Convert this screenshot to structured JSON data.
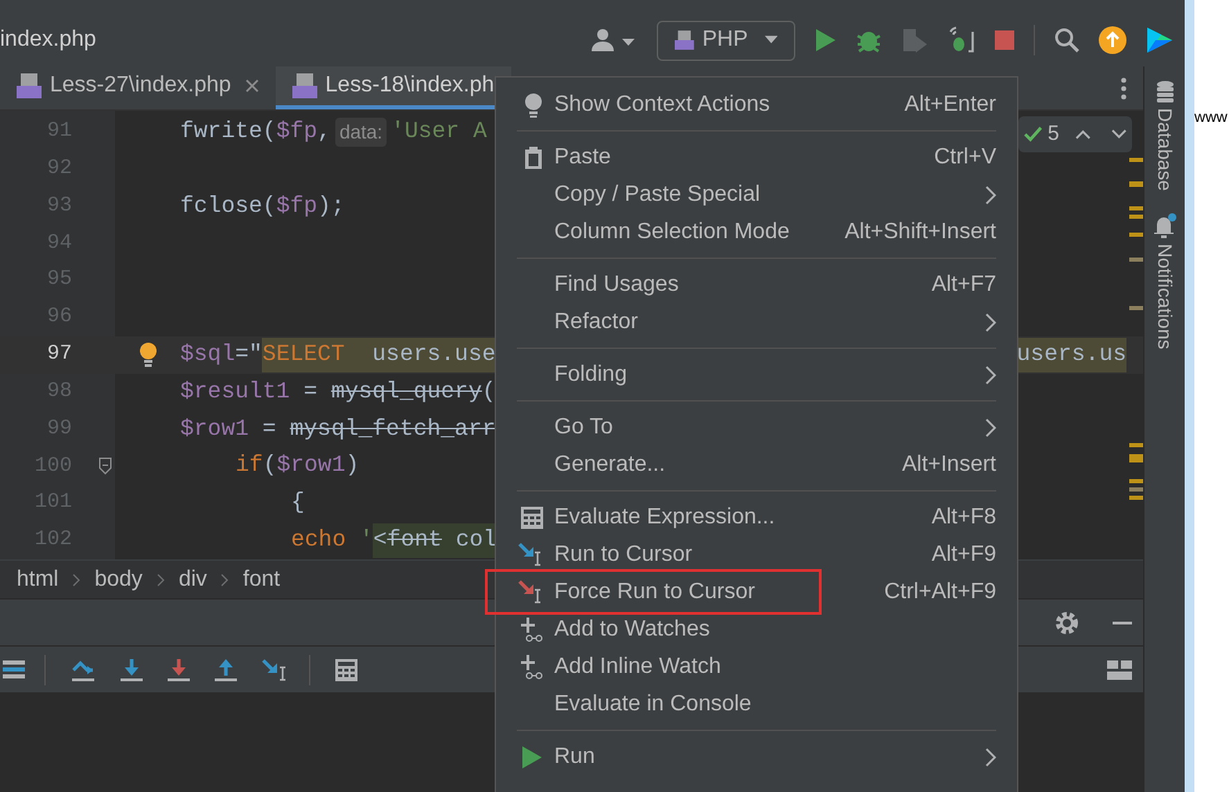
{
  "title_bar": {
    "file": "index.php",
    "run_config": "PHP"
  },
  "tabs": [
    {
      "label": "Less-27\\index.php",
      "selected": false
    },
    {
      "label": "Less-18\\index.ph",
      "selected": true
    }
  ],
  "editor": {
    "inspection_count": "5",
    "lines": [
      {
        "number": "91",
        "current": false,
        "fold": false,
        "tokens": [
          {
            "text": "fwrite(",
            "kind": "plain"
          },
          {
            "text": "$fp",
            "kind": "var"
          },
          {
            "text": ",",
            "kind": "plain"
          },
          {
            "text": "data:",
            "kind": "hint"
          },
          {
            "text": "'User A",
            "kind": "string"
          }
        ]
      },
      {
        "number": "92",
        "current": false,
        "fold": false
      },
      {
        "number": "93",
        "current": false,
        "fold": false,
        "tokens": [
          {
            "text": "fclose(",
            "kind": "plain"
          },
          {
            "text": "$fp",
            "kind": "var"
          },
          {
            "text": ");",
            "kind": "plain"
          }
        ]
      },
      {
        "number": "94",
        "current": false,
        "fold": false
      },
      {
        "number": "95",
        "current": false,
        "fold": false
      },
      {
        "number": "96",
        "current": false,
        "fold": false
      },
      {
        "number": "97",
        "current": true,
        "fold": false,
        "tokens": [
          {
            "text": "$sql",
            "kind": "var"
          },
          {
            "text": "=\"",
            "kind": "plain"
          },
          {
            "text": "SELECT",
            "kind": "sql_keyword"
          },
          {
            "text": "  users.use",
            "kind": "sql"
          }
        ],
        "right_text": "users.us"
      },
      {
        "number": "98",
        "current": false,
        "fold": false,
        "tokens": [
          {
            "text": "$result1",
            "kind": "var"
          },
          {
            "text": " = ",
            "kind": "plain"
          },
          {
            "text": "mysql_query",
            "kind": "deprecated"
          },
          {
            "text": "(",
            "kind": "plain"
          }
        ]
      },
      {
        "number": "99",
        "current": false,
        "fold": false,
        "tokens": [
          {
            "text": "$row1",
            "kind": "var"
          },
          {
            "text": " = ",
            "kind": "plain"
          },
          {
            "text": "mysql_fetch_arr",
            "kind": "deprecated"
          }
        ]
      },
      {
        "number": "100",
        "current": false,
        "fold": true,
        "kind": "nested",
        "tokens": [
          {
            "text": "if",
            "kind": "keyword"
          },
          {
            "text": "(",
            "kind": "plain"
          },
          {
            "text": "$row1",
            "kind": "var"
          },
          {
            "text": ")",
            "kind": "plain"
          }
        ],
        "children": [
          {
            "number": "101",
            "current": false,
            "fold": false,
            "tokens": [
              {
                "text": "{",
                "kind": "plain"
              }
            ]
          },
          {
            "number": "102",
            "current": false,
            "fold": false,
            "tokens": [
              {
                "text": "echo",
                "kind": "keyword"
              },
              {
                "text": " '",
                "kind": "string"
              },
              {
                "text": "<",
                "kind": "html"
              },
              {
                "text": "font",
                "kind": "html_deprecated"
              },
              {
                "text": " col",
                "kind": "html"
              }
            ]
          }
        ]
      }
    ]
  },
  "breadcrumbs": [
    "html",
    "body",
    "div",
    "font"
  ],
  "tool_windows": [
    "Database",
    "Notifications"
  ],
  "outer_window_text": "www",
  "context_menu": {
    "groups": [
      [
        {
          "label": "Show Context Actions",
          "shortcut": "Alt+Enter",
          "kind": "bulb",
          "submenu": false,
          "highlighted": false
        }
      ],
      [
        {
          "label": "Paste",
          "shortcut": "Ctrl+V",
          "kind": "clipboard",
          "submenu": false,
          "highlighted": false
        },
        {
          "label": "Copy / Paste Special",
          "submenu": true,
          "highlighted": false
        },
        {
          "label": "Column Selection Mode",
          "shortcut": "Alt+Shift+Insert",
          "submenu": false,
          "highlighted": false
        }
      ],
      [
        {
          "label": "Find Usages",
          "shortcut": "Alt+F7",
          "submenu": false,
          "highlighted": false
        },
        {
          "label": "Refactor",
          "submenu": true,
          "highlighted": false
        }
      ],
      [
        {
          "label": "Folding",
          "submenu": true,
          "highlighted": false
        }
      ],
      [
        {
          "label": "Go To",
          "submenu": true,
          "highlighted": false
        },
        {
          "label": "Generate...",
          "shortcut": "Alt+Insert",
          "submenu": false,
          "highlighted": false
        }
      ],
      [
        {
          "label": "Evaluate Expression...",
          "shortcut": "Alt+F8",
          "kind": "calculator",
          "submenu": false,
          "highlighted": false
        },
        {
          "label": "Run to Cursor",
          "shortcut": "Alt+F9",
          "kind": "run_to_cursor",
          "submenu": false,
          "highlighted": false
        },
        {
          "label": "Force Run to Cursor",
          "shortcut": "Ctrl+Alt+F9",
          "kind": "force_run_to_cursor",
          "submenu": false,
          "highlighted": true
        },
        {
          "label": "Add to Watches",
          "kind": "add_watch",
          "submenu": false,
          "highlighted": false
        },
        {
          "label": "Add Inline Watch",
          "kind": "add_watch",
          "submenu": false,
          "highlighted": false
        },
        {
          "label": "Evaluate in Console",
          "submenu": false,
          "highlighted": false
        }
      ],
      [
        {
          "label": "Run",
          "kind": "run",
          "submenu": true,
          "highlighted": false
        }
      ]
    ]
  }
}
